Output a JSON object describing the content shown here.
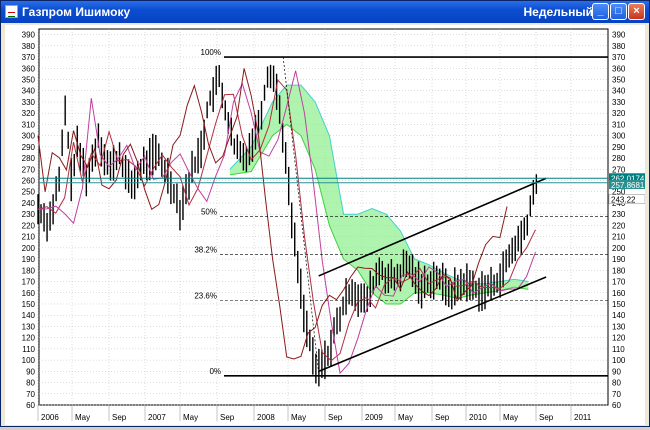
{
  "window": {
    "title": "Газпром Ишимоку",
    "period": "Недельный",
    "buttons": {
      "minimize": "_",
      "maximize": "□",
      "close": "×"
    }
  },
  "chart_data": {
    "type": "line",
    "title": "Газпром Ишимоку",
    "ylim": [
      60,
      395
    ],
    "y_ticks": [
      390,
      380,
      370,
      360,
      350,
      340,
      330,
      320,
      310,
      300,
      290,
      280,
      270,
      260,
      250,
      240,
      230,
      220,
      210,
      200,
      190,
      180,
      170,
      160,
      150,
      140,
      130,
      120,
      110,
      100,
      90,
      80,
      70,
      60
    ],
    "x_ticks": [
      "2006",
      "May",
      "Sep",
      "2007",
      "May",
      "Sep",
      "2008",
      "May",
      "Sep",
      "2009",
      "May",
      "Sep",
      "2010",
      "May",
      "Sep",
      "2011"
    ],
    "grid": true,
    "fib_levels": [
      {
        "label": "100%",
        "value": 370
      },
      {
        "label": "50%",
        "value": 228
      },
      {
        "label": "38.2%",
        "value": 194
      },
      {
        "label": "23.6%",
        "value": 153
      },
      {
        "label": "0%",
        "value": 86
      }
    ],
    "price_labels": [
      "262.0174",
      "257.8681",
      "243.22"
    ],
    "colors": {
      "price": "#000000",
      "tenkan": "#b03040",
      "kijun": "#c040a0",
      "chikou": "#8a1a1a",
      "senkou_a": "#40d040",
      "senkou_b": "#40d0d0",
      "cloud_green": "#8cef8c",
      "cloud_cyan": "#a8f0f0"
    }
  }
}
